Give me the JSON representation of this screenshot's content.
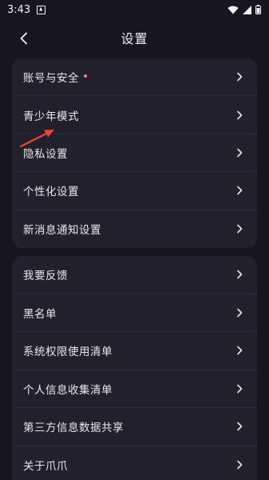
{
  "status_bar": {
    "time": "3:43",
    "icons": [
      "app-notification-icon",
      "wifi-icon",
      "signal-icon",
      "battery-icon"
    ]
  },
  "header": {
    "title": "设置",
    "back_icon": "chevron-left-icon"
  },
  "groups": [
    {
      "items": [
        {
          "label": "账号与安全",
          "badge": "red-dot"
        },
        {
          "label": "青少年模式"
        },
        {
          "label": "隐私设置"
        },
        {
          "label": "个性化设置"
        },
        {
          "label": "新消息通知设置"
        }
      ]
    },
    {
      "items": [
        {
          "label": "我要反馈"
        },
        {
          "label": "黑名单"
        },
        {
          "label": "系统权限使用清单"
        },
        {
          "label": "个人信息收集清单"
        },
        {
          "label": "第三方信息数据共享"
        },
        {
          "label": "关于爪爪"
        }
      ]
    }
  ],
  "colors": {
    "background": "#17161e",
    "card": "#22212b",
    "badge": "#ff6e9c",
    "annotation_arrow": "#e8453c"
  }
}
